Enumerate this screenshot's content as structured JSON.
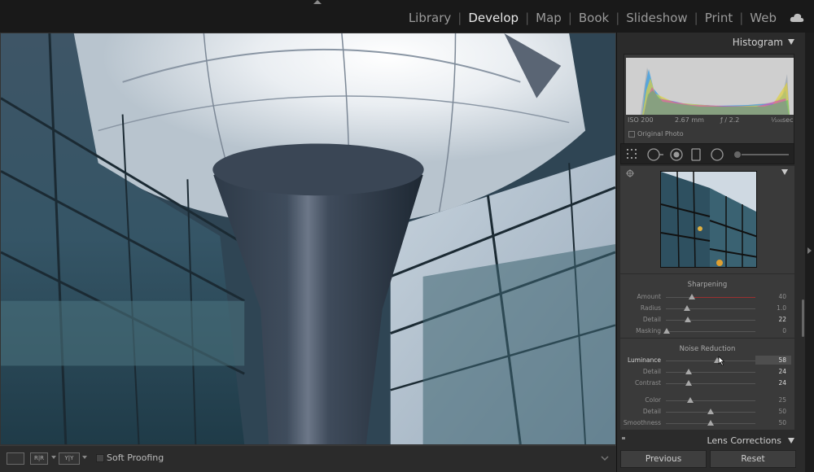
{
  "modules": [
    {
      "label": "Library",
      "active": false
    },
    {
      "label": "Develop",
      "active": true
    },
    {
      "label": "Map",
      "active": false
    },
    {
      "label": "Book",
      "active": false
    },
    {
      "label": "Slideshow",
      "active": false
    },
    {
      "label": "Print",
      "active": false
    },
    {
      "label": "Web",
      "active": false
    }
  ],
  "icons": {
    "cloud": "cloud-sync-icon",
    "tools": [
      "crop-overlay-icon",
      "spot-removal-icon",
      "red-eye-icon",
      "graduated-filter-icon",
      "radial-filter-icon",
      "adjustment-brush-icon"
    ]
  },
  "histogram": {
    "title": "Histogram",
    "iso": "ISO 200",
    "focal": "2.67 mm",
    "aperture": "ƒ / 2.2",
    "shutter_fraction": "¹⁄₁₀₀",
    "shutter_unit": "sec",
    "original_photo_label": "Original Photo"
  },
  "sharpening": {
    "title": "Sharpening",
    "rows": [
      {
        "label": "Amount",
        "value": "40",
        "level": 0.3,
        "red": true,
        "bright": false
      },
      {
        "label": "Radius",
        "value": "1.0",
        "level": 0.23,
        "red": false,
        "bright": false
      },
      {
        "label": "Detail",
        "value": "22",
        "level": 0.24,
        "red": false,
        "bright": true
      },
      {
        "label": "Masking",
        "value": "0",
        "level": 0.0,
        "red": false,
        "bright": false
      }
    ]
  },
  "noise_reduction": {
    "title": "Noise Reduction",
    "rows": [
      {
        "label": "Luminance",
        "value": "58",
        "level": 0.58,
        "highlighted": true,
        "bright": true
      },
      {
        "label": "Detail",
        "value": "24",
        "level": 0.24,
        "bright": true
      },
      {
        "label": "Contrast",
        "value": "24",
        "level": 0.24,
        "bright": true
      },
      {
        "label": "Color",
        "value": "25",
        "level": 0.25,
        "bright": false
      },
      {
        "label": "Detail",
        "value": "50",
        "level": 0.5,
        "bright": false
      },
      {
        "label": "Smoothness",
        "value": "50",
        "level": 0.5,
        "bright": false
      }
    ]
  },
  "lens_corrections": {
    "title": "Lens Corrections"
  },
  "buttons": {
    "previous": "Previous",
    "reset": "Reset"
  },
  "toolbar": {
    "soft_proofing_label": "Soft Proofing",
    "soft_proofing_checked": false,
    "view_mode": "loupe-view-icon",
    "compare_icons": [
      "before-after-icon",
      "before-after-split-icon"
    ]
  }
}
